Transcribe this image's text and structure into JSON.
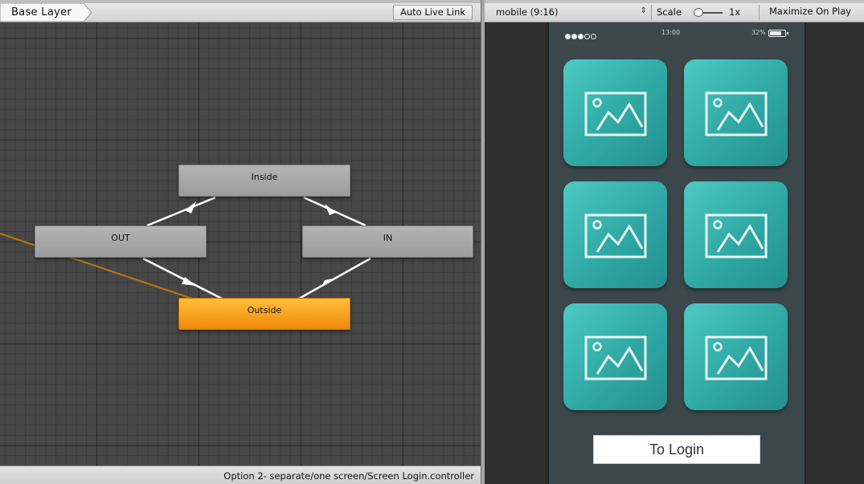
{
  "animator": {
    "layer_name": "Base Layer",
    "auto_live_link_label": "Auto Live Link",
    "states": {
      "inside": "Inside",
      "out": "OUT",
      "in": "IN",
      "outside": "Outside"
    },
    "status_path": "Option 2- separate/one screen/Screen Login.controller"
  },
  "game": {
    "aspect": "mobile (9:16)",
    "scale_label": "Scale",
    "scale_value": "1x",
    "maximize_label": "Maximize On Play",
    "phone": {
      "clock": "13:00",
      "battery": "32%",
      "tiles": [
        "image-icon",
        "image-icon",
        "image-icon",
        "image-icon",
        "image-icon",
        "image-icon"
      ],
      "login_button_label": "To Login"
    }
  },
  "colors": {
    "state_default": "#a8a8a8",
    "state_entry": "#f59a12",
    "tile_teal": "#35b0ab",
    "transition_orange": "#b57a10"
  }
}
